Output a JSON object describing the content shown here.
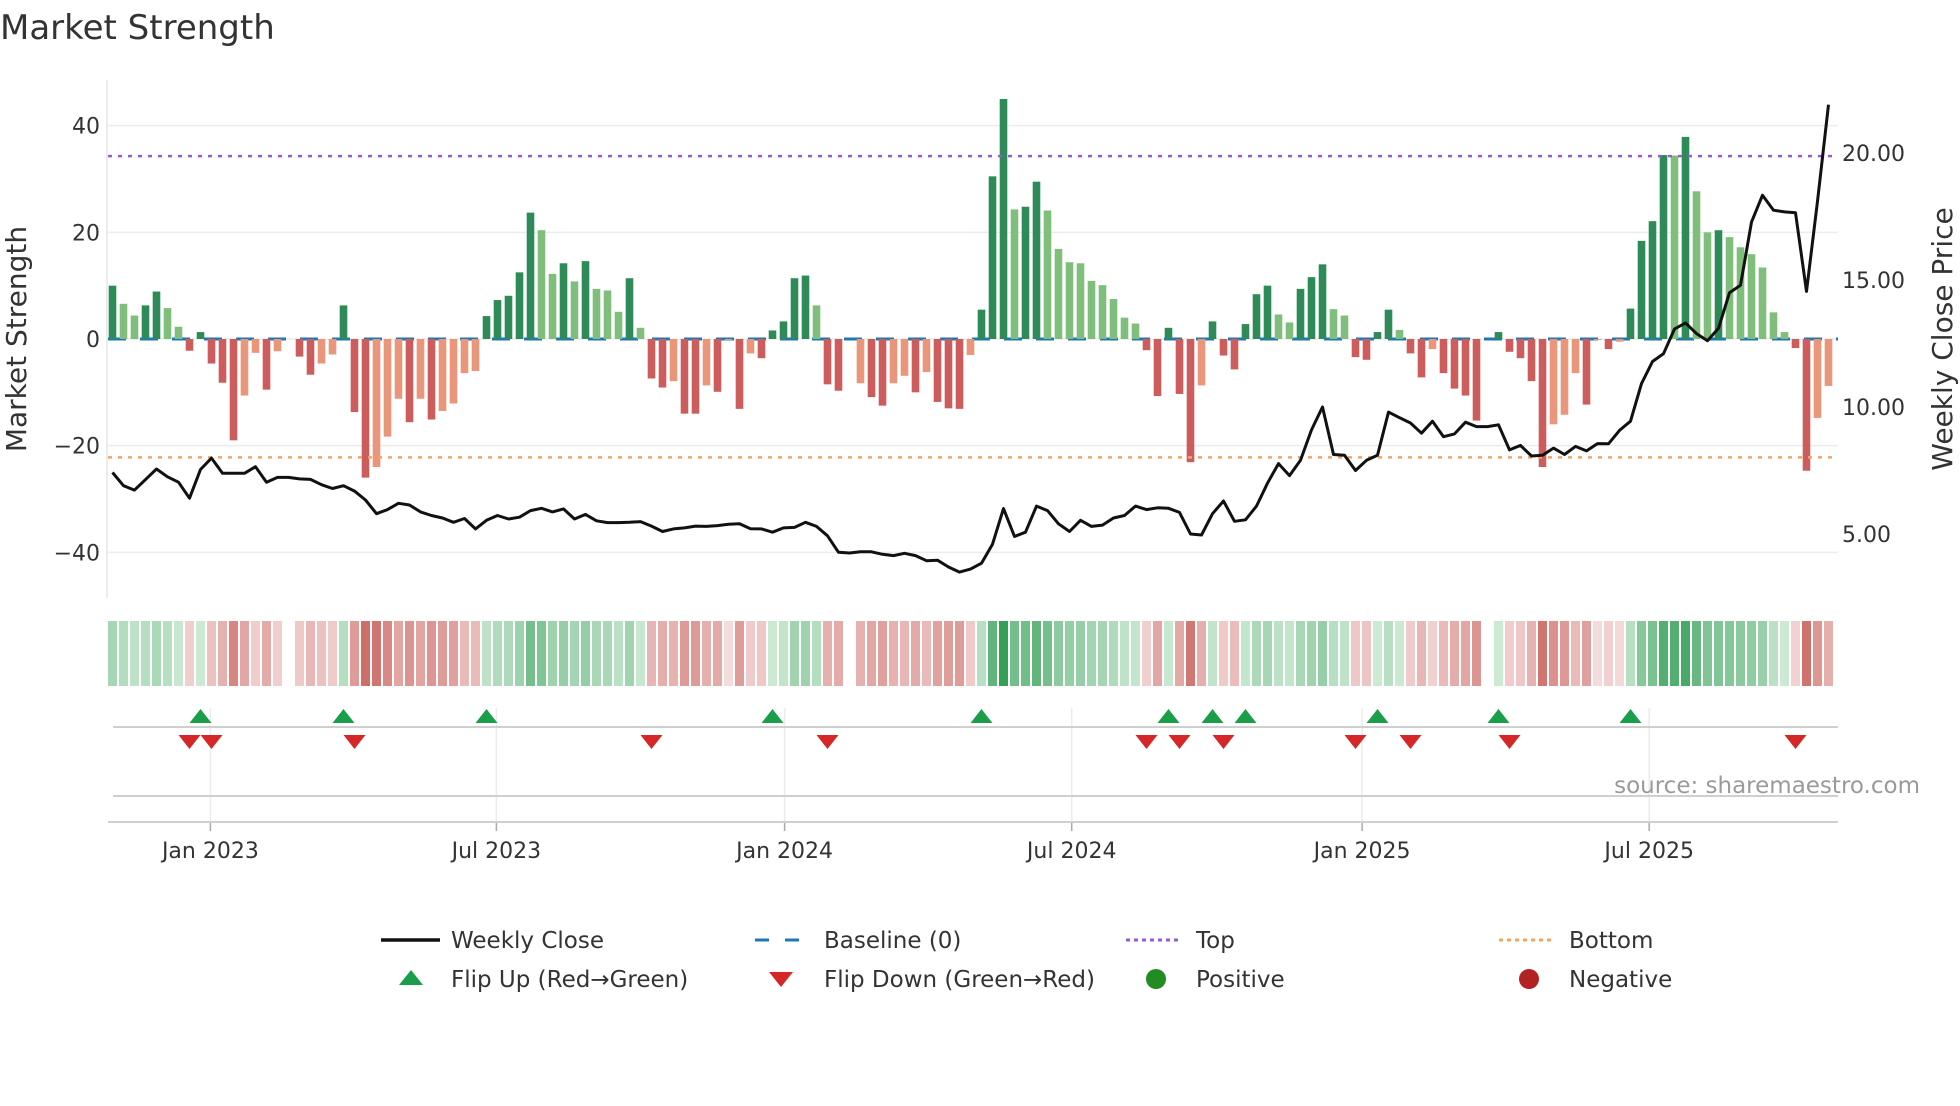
{
  "title": "Market Strength",
  "source_note": "source: sharemaestro.com",
  "colors": {
    "strong_green": "#2e8b57",
    "weak_green": "#7fbf7b",
    "strong_red": "#cd5c5c",
    "weak_red": "#e9967a",
    "baseline": "#1f77b4",
    "top": "#9b59d0",
    "bottom": "#f4a460",
    "line": "#111111",
    "flip_up": "#1a9e4a",
    "flip_down": "#d62728",
    "positive": "#228b22",
    "negative": "#b22222"
  },
  "legend": [
    {
      "label": "Weekly Close",
      "kind": "line"
    },
    {
      "label": "Baseline (0)",
      "kind": "dash"
    },
    {
      "label": "Top",
      "kind": "dot-top"
    },
    {
      "label": "Bottom",
      "kind": "dot-bottom"
    },
    {
      "label": "Flip Up (Red→Green)",
      "kind": "tri-up"
    },
    {
      "label": "Flip Down (Green→Red)",
      "kind": "tri-down"
    },
    {
      "label": "Positive",
      "kind": "pos"
    },
    {
      "label": "Negative",
      "kind": "neg"
    }
  ],
  "chart_data": {
    "type": "bar",
    "title": "Market Strength",
    "ylabel": "Market Strength",
    "y2label": "Weekly Close Price",
    "ylim": [
      -48,
      50
    ],
    "y2lim": [
      2.9,
      22.8
    ],
    "y_ticks": [
      {
        "v": 40,
        "label": "40"
      },
      {
        "v": 20,
        "label": "20"
      },
      {
        "v": 0,
        "label": "0"
      },
      {
        "v": -20,
        "label": "−20"
      },
      {
        "v": -40,
        "label": "−40"
      }
    ],
    "y2_ticks": [
      {
        "v": 20,
        "label": "20.00"
      },
      {
        "v": 15,
        "label": "15.00"
      },
      {
        "v": 10,
        "label": "10.00"
      },
      {
        "v": 5,
        "label": "5.00"
      }
    ],
    "x_ticks": [
      {
        "label": "Jan 2023",
        "week": 8.9
      },
      {
        "label": "Jul 2023",
        "week": 34.9
      },
      {
        "label": "Jan 2024",
        "week": 61.1
      },
      {
        "label": "Jul 2024",
        "week": 87.2
      },
      {
        "label": "Jan 2025",
        "week": 113.6
      },
      {
        "label": "Jul 2025",
        "week": 139.7
      }
    ],
    "top_level": 34.3,
    "bottom_level": -22.2,
    "strength": [
      10,
      6.6,
      4.4,
      6.3,
      8.9,
      5.8,
      2.3,
      -2.2,
      1.3,
      -4.6,
      -8.2,
      -19,
      -10.6,
      -2.6,
      -9.5,
      -2.3,
      0,
      -3.3,
      -6.7,
      -4.6,
      -2.9,
      6.3,
      -13.7,
      -26,
      -24,
      -18.3,
      -11.2,
      -15.6,
      -11.2,
      -15.1,
      -13.5,
      -12.1,
      -6.4,
      -6,
      4.3,
      7.3,
      8.1,
      12.5,
      23.7,
      20.4,
      12.2,
      14.2,
      10.8,
      14.6,
      9.4,
      9.1,
      5.1,
      11.4,
      2.1,
      -7.4,
      -9.1,
      -7.9,
      -14,
      -14,
      -8.7,
      -9.9,
      -0.2,
      -13.1,
      -2.7,
      -3.6,
      1.6,
      3.3,
      11.4,
      11.9,
      6.3,
      -8.5,
      -9.7,
      0,
      -8.3,
      -10.9,
      -12.5,
      -8.3,
      -6.9,
      -10,
      -6.2,
      -11.8,
      -13,
      -13.1,
      -3,
      5.5,
      30.5,
      45,
      24.3,
      24.8,
      29.5,
      24.1,
      16.9,
      14.4,
      14.2,
      10.9,
      10.1,
      7.5,
      4,
      2.9,
      -2.1,
      -10.7,
      2.1,
      -10.3,
      -23.1,
      -8.7,
      3.3,
      -3.1,
      -5.7,
      2.8,
      8.4,
      10,
      4.6,
      3.1,
      9.4,
      11.6,
      14,
      5.6,
      4.4,
      -3.4,
      -3.9,
      1.3,
      5.5,
      1.7,
      -2.7,
      -7.2,
      -1.9,
      -6.4,
      -9.3,
      -10.6,
      -15.3,
      0,
      1.3,
      -2.4,
      -3.6,
      -7.9,
      -24,
      -16,
      -14.2,
      -6.4,
      -12.3,
      -0.2,
      -1.9,
      -0.5,
      5.7,
      18.4,
      22.1,
      34.5,
      34.4,
      37.9,
      27.7,
      20,
      20.4,
      19.1,
      17.2,
      15.9,
      13.4,
      5,
      1.3,
      -1.7,
      -24.7,
      -14.8,
      -8.8
    ],
    "strong": [
      1,
      0,
      0,
      1,
      1,
      0,
      0,
      1,
      1,
      1,
      1,
      1,
      0,
      0,
      1,
      0,
      0,
      1,
      1,
      0,
      0,
      1,
      1,
      1,
      0,
      0,
      0,
      1,
      0,
      1,
      0,
      0,
      0,
      0,
      1,
      1,
      1,
      1,
      1,
      0,
      0,
      1,
      0,
      1,
      0,
      0,
      0,
      1,
      0,
      1,
      1,
      0,
      1,
      1,
      0,
      1,
      0,
      1,
      0,
      1,
      1,
      1,
      1,
      1,
      0,
      1,
      1,
      0,
      0,
      1,
      1,
      0,
      0,
      1,
      0,
      1,
      1,
      1,
      0,
      1,
      1,
      1,
      0,
      1,
      1,
      0,
      0,
      0,
      0,
      0,
      0,
      0,
      0,
      0,
      1,
      1,
      1,
      1,
      1,
      0,
      1,
      1,
      1,
      1,
      1,
      1,
      0,
      0,
      1,
      1,
      1,
      0,
      0,
      1,
      1,
      1,
      1,
      0,
      1,
      1,
      0,
      1,
      1,
      1,
      1,
      0,
      1,
      1,
      1,
      1,
      1,
      0,
      0,
      0,
      1,
      0,
      1,
      0,
      1,
      1,
      1,
      1,
      0,
      1,
      0,
      0,
      1,
      0,
      0,
      0,
      0,
      0,
      0,
      1,
      1,
      0,
      0
    ],
    "weekly_close": [
      7.42,
      6.9,
      6.73,
      7.14,
      7.56,
      7.25,
      7.04,
      6.41,
      7.54,
      7.99,
      7.39,
      7.39,
      7.39,
      7.65,
      7.04,
      7.23,
      7.23,
      7.17,
      7.15,
      6.94,
      6.79,
      6.9,
      6.69,
      6.34,
      5.8,
      5.96,
      6.21,
      6.14,
      5.87,
      5.73,
      5.63,
      5.46,
      5.61,
      5.2,
      5.54,
      5.73,
      5.59,
      5.66,
      5.92,
      6.01,
      5.87,
      5.99,
      5.59,
      5.77,
      5.52,
      5.45,
      5.45,
      5.46,
      5.49,
      5.31,
      5.1,
      5.2,
      5.24,
      5.31,
      5.3,
      5.33,
      5.38,
      5.4,
      5.21,
      5.2,
      5.07,
      5.24,
      5.26,
      5.46,
      5.3,
      4.93,
      4.28,
      4.25,
      4.3,
      4.3,
      4.2,
      4.15,
      4.24,
      4.15,
      3.95,
      3.97,
      3.7,
      3.5,
      3.62,
      3.85,
      4.6,
      6.0,
      4.9,
      5.07,
      6.1,
      5.92,
      5.4,
      5.1,
      5.54,
      5.3,
      5.35,
      5.63,
      5.73,
      6.1,
      5.96,
      6.03,
      6.01,
      5.85,
      5.0,
      4.96,
      5.8,
      6.3,
      5.5,
      5.56,
      6.1,
      7.0,
      7.77,
      7.3,
      7.9,
      9.1,
      10.0,
      8.13,
      8.1,
      7.5,
      7.9,
      8.1,
      9.8,
      9.58,
      9.37,
      8.97,
      9.44,
      8.83,
      8.94,
      9.4,
      9.23,
      9.23,
      9.3,
      8.31,
      8.49,
      8.07,
      8.1,
      8.38,
      8.13,
      8.45,
      8.27,
      8.56,
      8.55,
      9.08,
      9.44,
      10.92,
      11.79,
      12.1,
      13.07,
      13.31,
      12.89,
      12.61,
      13.1,
      14.5,
      14.79,
      17.28,
      18.34,
      17.75,
      17.68,
      17.65,
      14.55,
      18.1,
      21.9
    ],
    "flip_up_weeks": [
      8,
      21,
      34,
      60,
      79,
      96,
      100,
      103,
      115,
      126,
      138
    ],
    "flip_down_weeks": [
      7,
      9,
      22,
      49,
      65,
      94,
      97,
      101,
      113,
      118,
      127,
      153
    ]
  }
}
